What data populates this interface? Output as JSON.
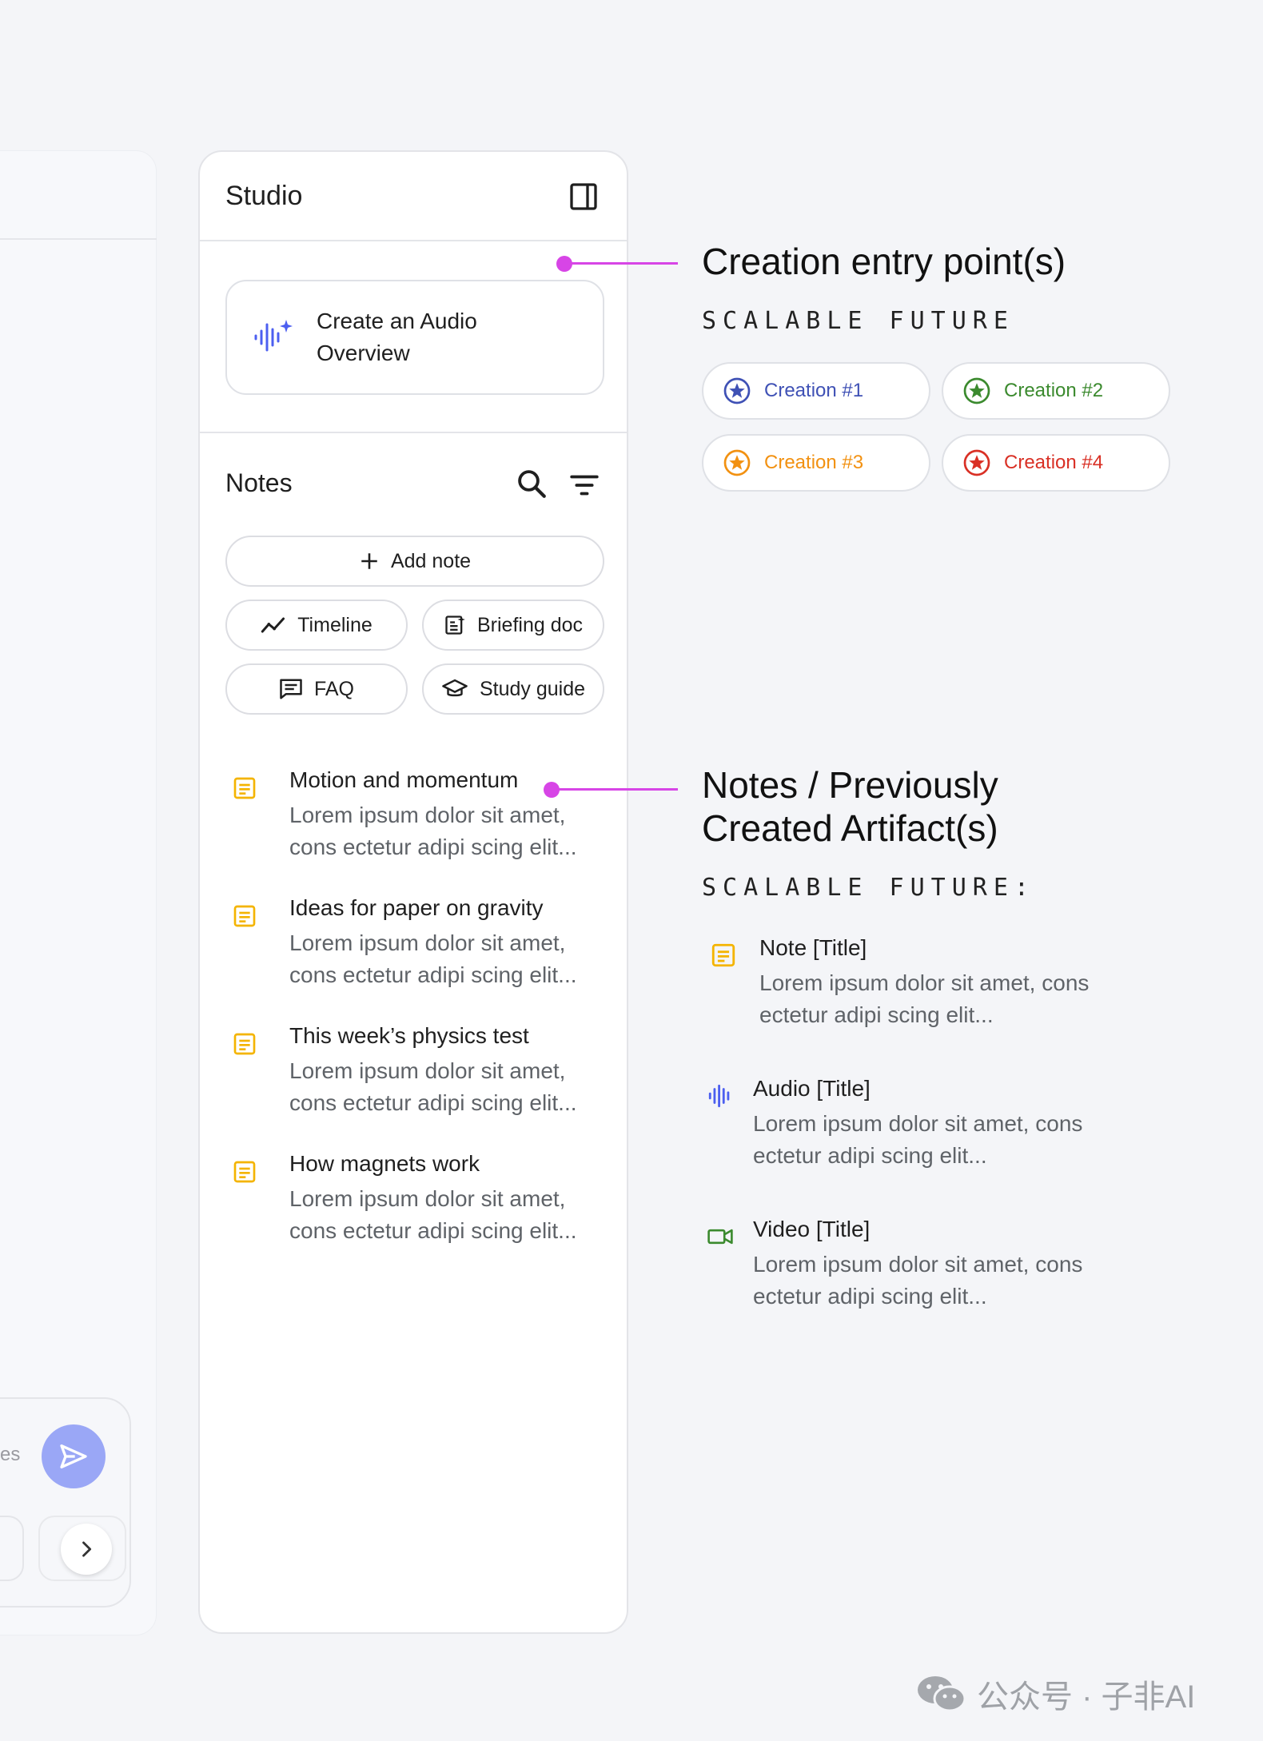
{
  "studio": {
    "title": "Studio",
    "create_card": "Create an Audio Overview",
    "notes_title": "Notes",
    "add_note": "Add note",
    "quick_actions": [
      "Timeline",
      "Briefing doc",
      "FAQ",
      "Study guide"
    ],
    "notes": [
      {
        "title": "Motion and momentum",
        "body": "Lorem ipsum dolor sit amet, cons ectetur adipi scing elit..."
      },
      {
        "title": "Ideas for paper on gravity",
        "body": "Lorem ipsum dolor sit amet, cons ectetur adipi scing elit..."
      },
      {
        "title": "This week’s physics test",
        "body": "Lorem ipsum dolor sit amet, cons ectetur adipi scing elit..."
      },
      {
        "title": "How magnets work",
        "body": "Lorem ipsum dolor sit amet, cons ectetur adipi scing elit..."
      }
    ]
  },
  "annotations": {
    "creation": {
      "title": "Creation entry point(s)",
      "subtitle": "SCALABLE FUTURE",
      "pills": [
        {
          "label": "Creation #1",
          "color": "#3f51b5"
        },
        {
          "label": "Creation #2",
          "color": "#3b8a2e"
        },
        {
          "label": "Creation #3",
          "color": "#f29111"
        },
        {
          "label": "Creation #4",
          "color": "#d93025"
        }
      ]
    },
    "notes": {
      "title_line1": "Notes / Previously",
      "title_line2": "Created Artifact(s)",
      "subtitle": "SCALABLE FUTURE:",
      "items": [
        {
          "icon": "note-icon",
          "title": "Note [Title]",
          "body": "Lorem ipsum dolor sit amet, cons ectetur adipi scing elit..."
        },
        {
          "icon": "audio-icon",
          "title": "Audio [Title]",
          "body": "Lorem ipsum dolor sit amet, cons ectetur adipi scing elit..."
        },
        {
          "icon": "video-icon",
          "title": "Video [Title]",
          "body": "Lorem ipsum dolor sit amet, cons ectetur adipi scing elit..."
        }
      ]
    }
  },
  "left_panel": {
    "composer_hint": "es"
  },
  "watermark": "公众号 · 子非AI",
  "colors": {
    "accent_connector": "#d745e6",
    "note_icon": "#f4b400",
    "audio_icon": "#4c5ff0",
    "video_icon": "#3b8a2e",
    "send_button": "#9aa7f6"
  }
}
